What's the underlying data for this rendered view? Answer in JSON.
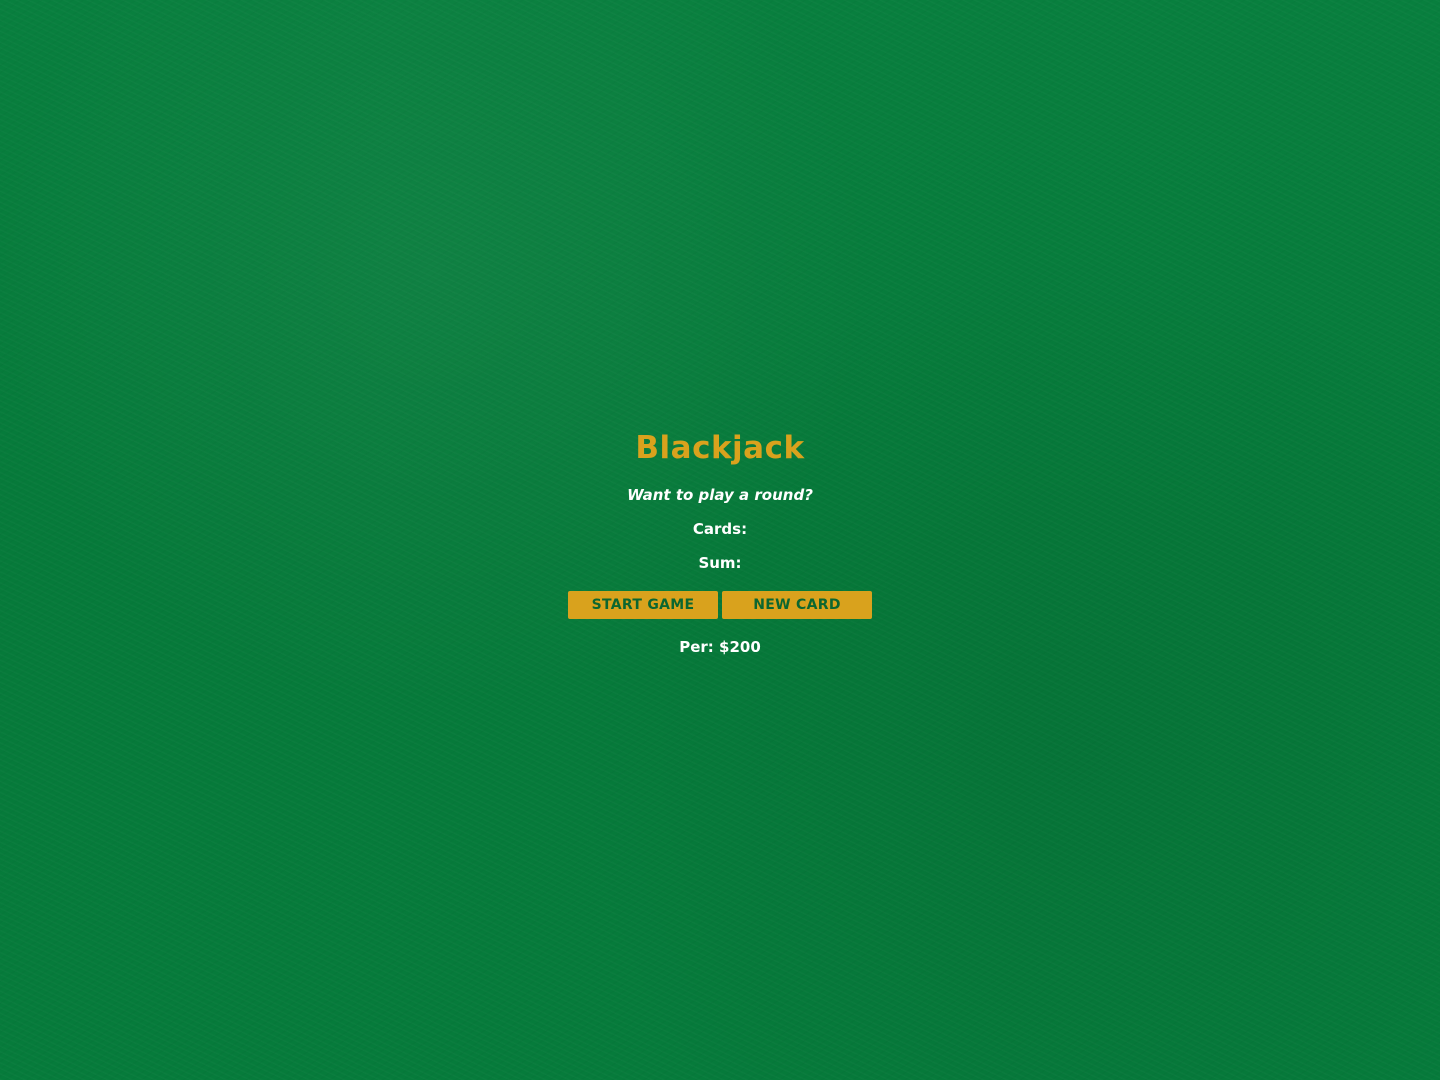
{
  "game": {
    "title": "Blackjack",
    "message": "Want to play a round?",
    "cards_label": "Cards:",
    "cards_value": "",
    "sum_label": "Sum:",
    "sum_value": "",
    "start_button_label": "START GAME",
    "new_card_button_label": "NEW CARD",
    "player_text": "Per: $200"
  },
  "colors": {
    "felt_green": "#067a3a",
    "accent_gold": "#d9a21d",
    "text_white": "#ffffff",
    "button_text_green": "#0b6630"
  }
}
